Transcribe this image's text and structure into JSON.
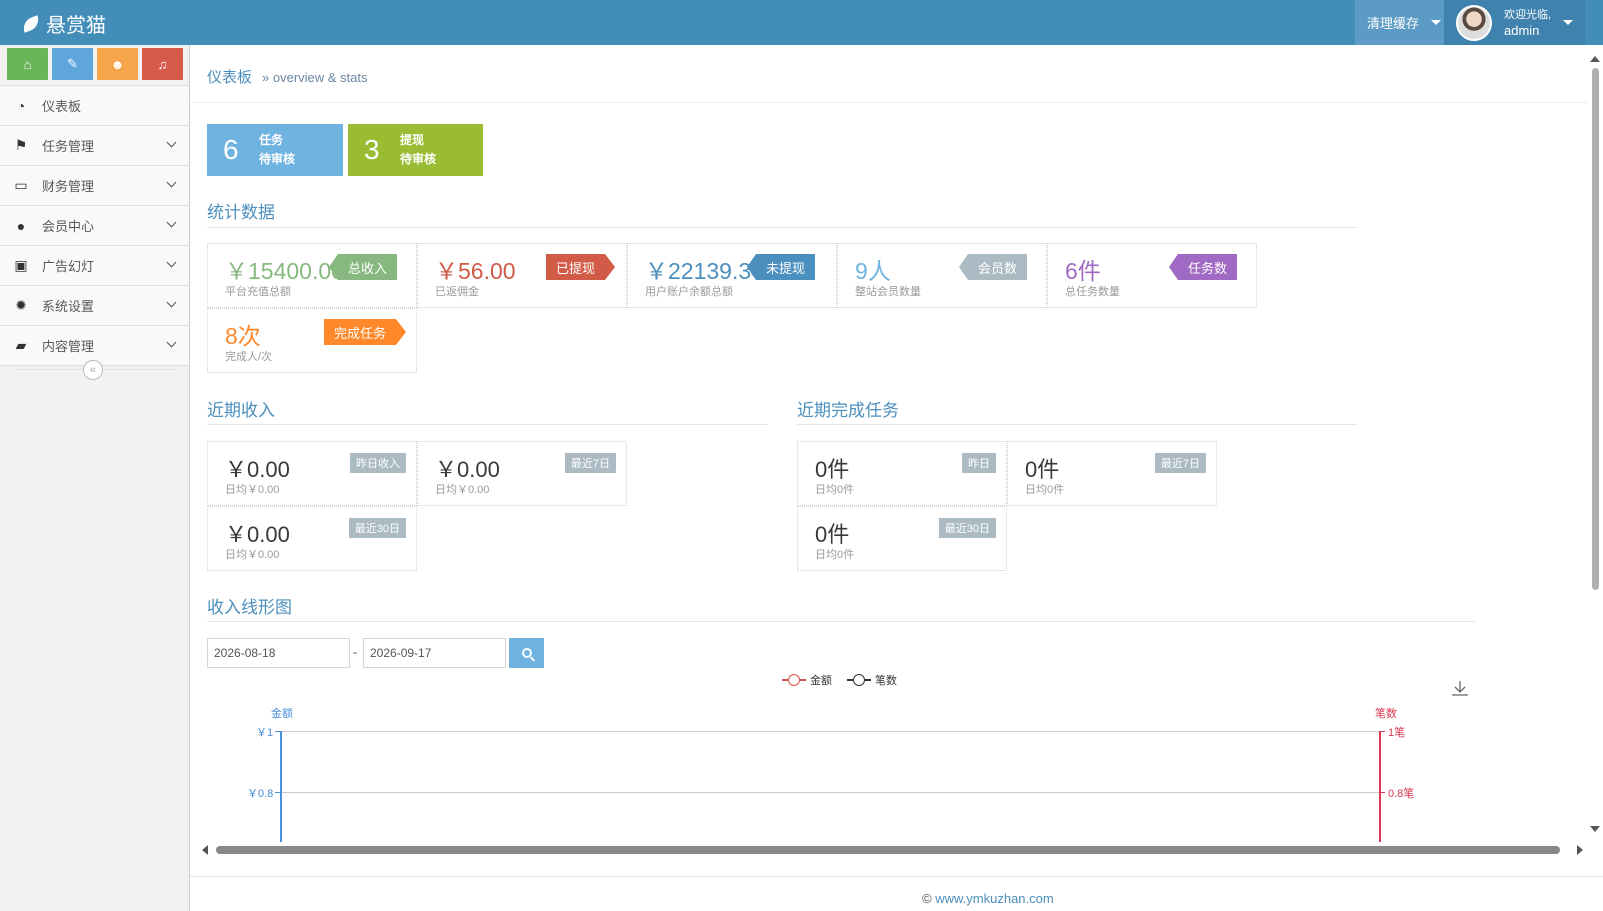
{
  "brand": {
    "name": "悬赏猫"
  },
  "navbar": {
    "clear_cache": "清理缓存",
    "welcome": "欢迎光临,",
    "username": "admin"
  },
  "sidebar": {
    "items": [
      {
        "label": "仪表板",
        "icon": "dashboard-icon",
        "glyph": "◔"
      },
      {
        "label": "任务管理",
        "icon": "flag-icon",
        "glyph": "⚑"
      },
      {
        "label": "财务管理",
        "icon": "hdd-icon",
        "glyph": "▭"
      },
      {
        "label": "会员中心",
        "icon": "user-icon",
        "glyph": "●"
      },
      {
        "label": "广告幻灯",
        "icon": "picture-icon",
        "glyph": "▣"
      },
      {
        "label": "系统设置",
        "icon": "cog-icon",
        "glyph": "✹"
      },
      {
        "label": "内容管理",
        "icon": "book-icon",
        "glyph": "▰"
      }
    ]
  },
  "breadcrumb": {
    "title": "仪表板",
    "sub": "» overview & stats"
  },
  "infoboxes": [
    {
      "num": "6",
      "line1": "任务",
      "line2": "待审核",
      "color": "#6fb3e0"
    },
    {
      "num": "3",
      "line1": "提现",
      "line2": "待审核",
      "color": "#9abc32"
    }
  ],
  "stats": {
    "title": "统计数据",
    "items": [
      {
        "value": "￥15400.00",
        "label": "平台充值总额",
        "tag": "总收入",
        "color": "#87b87f"
      },
      {
        "value": "￥56.00",
        "label": "已返佣金",
        "tag": "已提现",
        "color": "#d15b47"
      },
      {
        "value": "￥22139.34",
        "label": "用户账户余额总额",
        "tag": "未提现",
        "color": "#4a8fbd"
      },
      {
        "value": "9人",
        "label": "整站会员数量",
        "tag": "会员数",
        "color": "#abbac3"
      },
      {
        "value": "6件",
        "label": "总任务数量",
        "tag": "任务数",
        "color": "#a069c3"
      },
      {
        "value": "8次",
        "label": "完成人/次",
        "tag": "完成任务",
        "color": "#ff892a"
      }
    ]
  },
  "recent_income": {
    "title": "近期收入",
    "items": [
      {
        "value": "￥0.00",
        "label": "日均￥0.00",
        "tag": "昨日收入"
      },
      {
        "value": "￥0.00",
        "label": "日均￥0.00",
        "tag": "最近7日"
      },
      {
        "value": "￥0.00",
        "label": "日均￥0.00",
        "tag": "最近30日"
      }
    ]
  },
  "recent_tasks": {
    "title": "近期完成任务",
    "items": [
      {
        "value": "0件",
        "label": "日均0件",
        "tag": "昨日"
      },
      {
        "value": "0件",
        "label": "日均0件",
        "tag": "最近7日"
      },
      {
        "value": "0件",
        "label": "日均0件",
        "tag": "最近30日"
      }
    ]
  },
  "income_chart": {
    "title": "收入线形图",
    "date_from": "2026-08-18",
    "date_to": "2026-09-17",
    "separator": "-"
  },
  "chart_data": {
    "type": "line",
    "legend": [
      "金额",
      "笔数"
    ],
    "legend_colors": [
      "#d9534f",
      "#333333"
    ],
    "left_axis": {
      "title": "金额",
      "color": "#4a90d9",
      "ticks": [
        "￥1",
        "￥0.8"
      ]
    },
    "right_axis": {
      "title": "笔数",
      "color": "#d9364f",
      "ticks": [
        "1笔",
        "0.8笔"
      ]
    },
    "series": []
  },
  "footer": {
    "copyright": "©",
    "link": "www.ymkuzhan.com"
  }
}
